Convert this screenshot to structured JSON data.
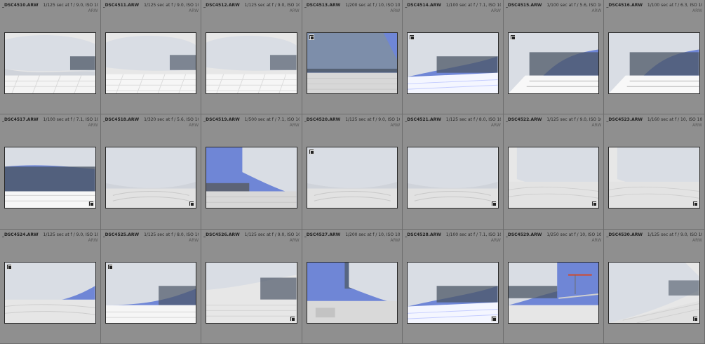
{
  "grid": {
    "cells": [
      {
        "filename": "_DSC4510.ARW",
        "exposure": "1/125 sec at f / 9.0, ISO 100, 24 m...",
        "format": "ARW",
        "variant": "a",
        "badge": ""
      },
      {
        "filename": "_DSC4511.ARW",
        "exposure": "1/125 sec at f / 9.0, ISO 100, 24 m...",
        "format": "ARW",
        "variant": "b",
        "badge": ""
      },
      {
        "filename": "_DSC4512.ARW",
        "exposure": "1/125 sec at f / 9.0, ISO 100, 24 m...",
        "format": "ARW",
        "variant": "b",
        "badge": ""
      },
      {
        "filename": "_DSC4513.ARW",
        "exposure": "1/200 sec at f / 10, ISO 100, 24 m...",
        "format": "ARW",
        "variant": "c",
        "badge": "tl"
      },
      {
        "filename": "_DSC4514.ARW",
        "exposure": "1/100 sec at f / 7.1, ISO 100, 24 m...",
        "format": "ARW",
        "variant": "d",
        "badge": "tl"
      },
      {
        "filename": "_DSC4515.ARW",
        "exposure": "1/100 sec at f / 5.6, ISO 100, 49 m...",
        "format": "ARW",
        "variant": "e",
        "badge": "tl"
      },
      {
        "filename": "_DSC4516.ARW",
        "exposure": "1/100 sec at f / 6.3, ISO 100, 49 m...",
        "format": "ARW",
        "variant": "e",
        "badge": ""
      },
      {
        "filename": "_DSC4517.ARW",
        "exposure": "1/100 sec at f / 7.1, ISO 100, 49 m...",
        "format": "ARW",
        "variant": "f",
        "badge": "br"
      },
      {
        "filename": "_DSC4518.ARW",
        "exposure": "1/320 sec at f / 5.6, ISO 100, 35 m...",
        "format": "ARW",
        "variant": "g",
        "badge": "br"
      },
      {
        "filename": "_DSC4519.ARW",
        "exposure": "1/500 sec at f / 7.1, ISO 100, 35 m...",
        "format": "ARW",
        "variant": "h",
        "badge": ""
      },
      {
        "filename": "_DSC4520.ARW",
        "exposure": "1/125 sec at f / 9.0, ISO 100, 35 m...",
        "format": "ARW",
        "variant": "g",
        "badge": "tl"
      },
      {
        "filename": "_DSC4521.ARW",
        "exposure": "1/125 sec at f / 8.0, ISO 100, 35 m...",
        "format": "ARW",
        "variant": "g",
        "badge": "br"
      },
      {
        "filename": "_DSC4522.ARW",
        "exposure": "1/125 sec at f / 9.0, ISO 100, 24 m...",
        "format": "ARW",
        "variant": "i",
        "badge": "br"
      },
      {
        "filename": "_DSC4523.ARW",
        "exposure": "1/160 sec at f / 10, ISO 100, 24 m...",
        "format": "ARW",
        "variant": "i",
        "badge": "br"
      },
      {
        "filename": "_DSC4524.ARW",
        "exposure": "1/125 sec at f / 9.0, ISO 100, 24 m...",
        "format": "ARW",
        "variant": "j",
        "badge": "tl"
      },
      {
        "filename": "_DSC4525.ARW",
        "exposure": "1/125 sec at f / 8.0, ISO 100, 24 m...",
        "format": "ARW",
        "variant": "k",
        "badge": "tl"
      },
      {
        "filename": "_DSC4526.ARW",
        "exposure": "1/125 sec at f / 9.0, ISO 100, 24 m...",
        "format": "ARW",
        "variant": "l",
        "badge": "br"
      },
      {
        "filename": "_DSC4527.ARW",
        "exposure": "1/200 sec at f / 10, ISO 100, 24 m...",
        "format": "ARW",
        "variant": "m",
        "badge": ""
      },
      {
        "filename": "_DSC4528.ARW",
        "exposure": "1/100 sec at f / 7.1, ISO 100, 24 m...",
        "format": "ARW",
        "variant": "d",
        "badge": "br"
      },
      {
        "filename": "_DSC4529.ARW",
        "exposure": "1/250 sec at f / 10, ISO 100, 24 m...",
        "format": "ARW",
        "variant": "n",
        "badge": ""
      },
      {
        "filename": "_DSC4530.ARW",
        "exposure": "1/125 sec at f / 9.0, ISO 100, 24 m...",
        "format": "ARW",
        "variant": "o",
        "badge": "br"
      }
    ]
  },
  "colors": {
    "cell_bg": "#8f8f8f",
    "grid_line": "#6e6e6e",
    "sky": "#6f86d6",
    "facade": "#d9dde4",
    "ground": "#e7e7e7",
    "glass": "#4b5666"
  }
}
